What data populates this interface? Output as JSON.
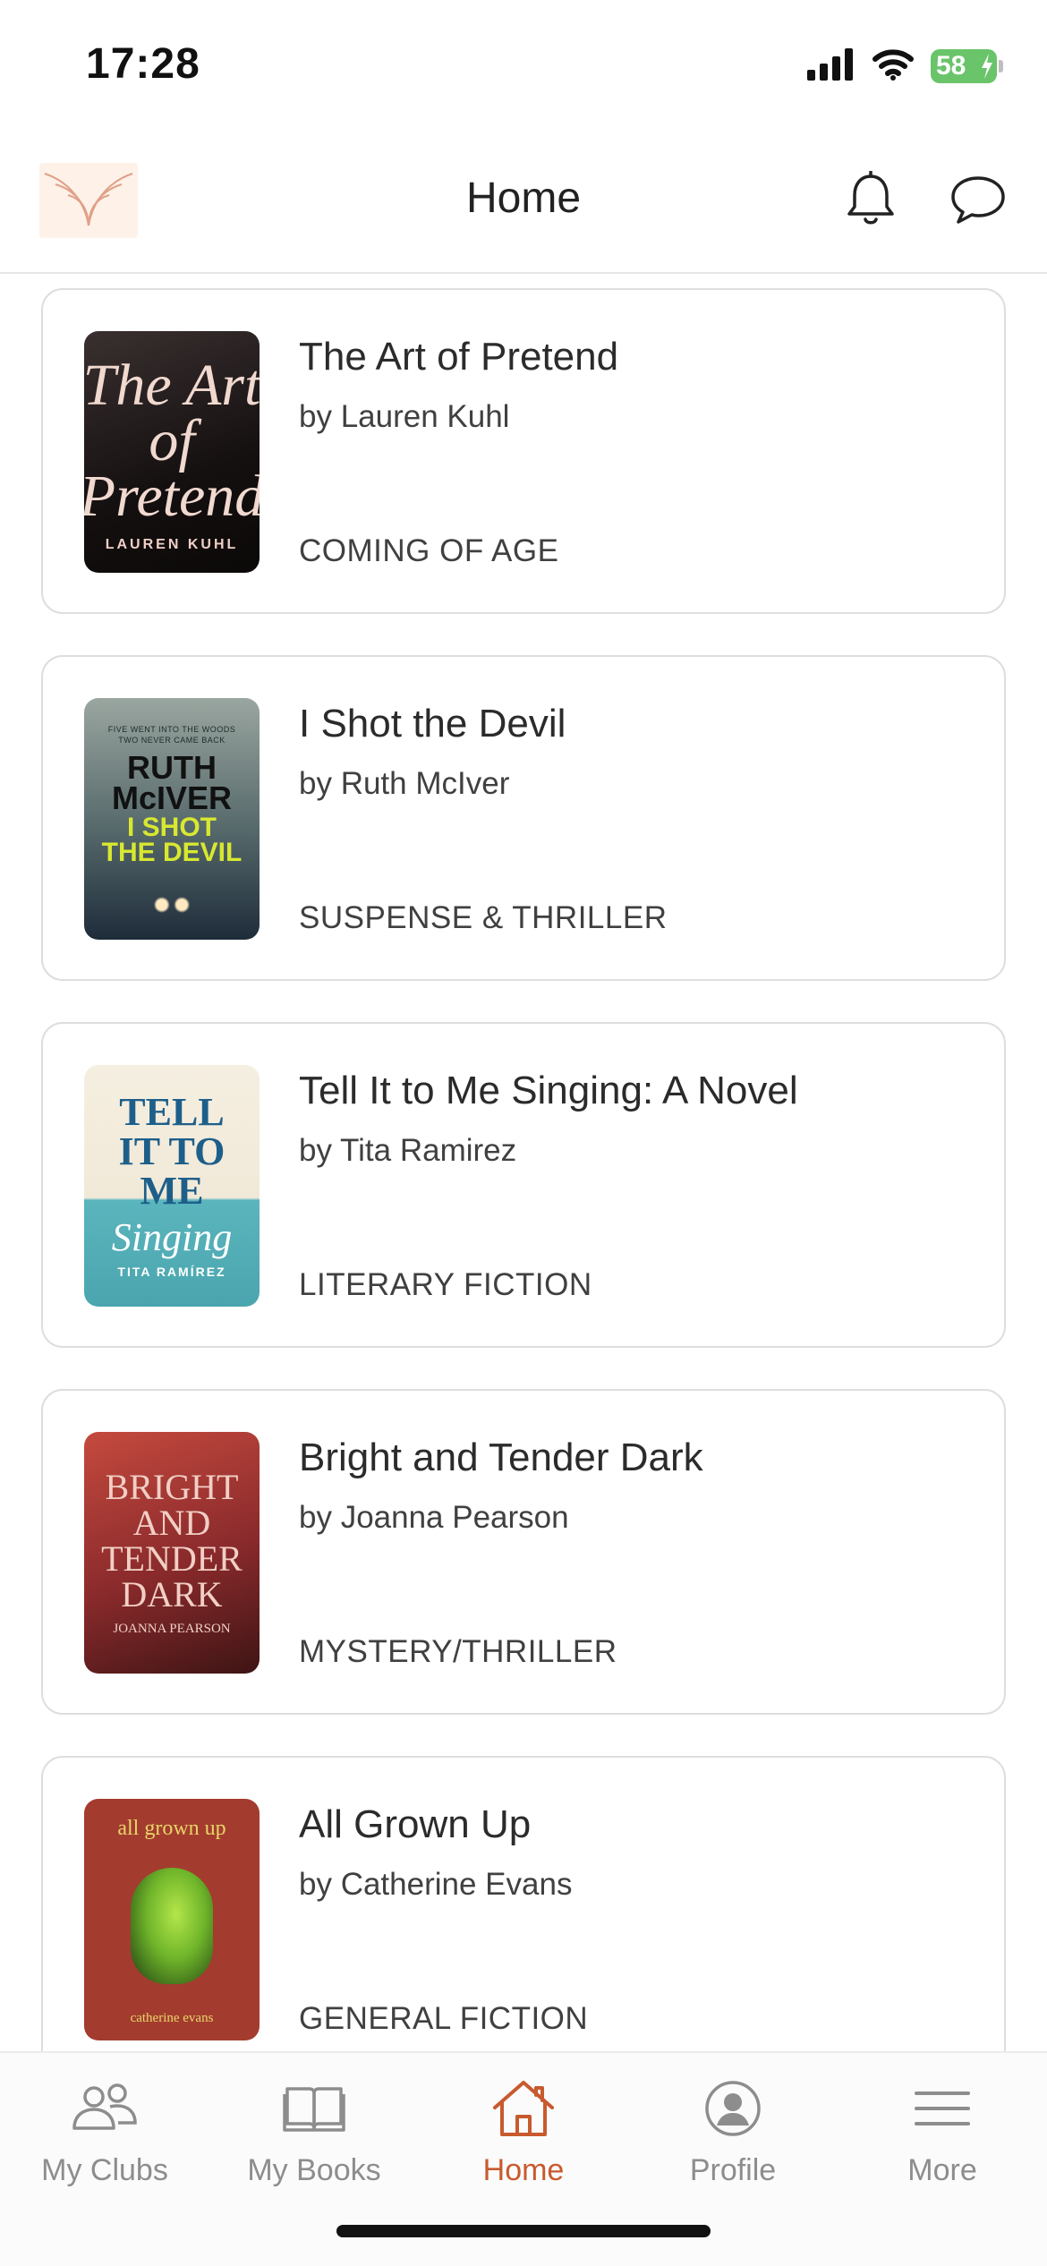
{
  "status_bar": {
    "time": "17:28",
    "battery_percent": "58",
    "icons": [
      "signal-icon",
      "wifi-icon",
      "battery-icon"
    ]
  },
  "header": {
    "title": "Home",
    "icons": [
      "app-logo",
      "bell-icon",
      "chat-bubble-icon"
    ]
  },
  "books": [
    {
      "title": "The Art of Pretend",
      "author": "by Lauren Kuhl",
      "genre": "COMING OF AGE",
      "cover": {
        "title_text": "The Art of Pretend",
        "author_text": "LAUREN KUHL"
      }
    },
    {
      "title": "I Shot the Devil",
      "author": "by Ruth McIver",
      "genre": "SUSPENSE & THRILLER",
      "cover": {
        "tagline": "FIVE WENT INTO THE WOODS TWO NEVER CAME BACK",
        "author_text": "RUTH McIVER",
        "title_text": "I SHOT THE DEVIL"
      }
    },
    {
      "title": "Tell It to Me Singing: A Novel",
      "author": "by Tita Ramirez",
      "genre": "LITERARY FICTION",
      "cover": {
        "title_text": "TELL IT TO ME",
        "title_script": "Singing",
        "author_text": "TITA RAMÍREZ"
      }
    },
    {
      "title": "Bright and Tender Dark",
      "author": "by Joanna Pearson",
      "genre": "MYSTERY/THRILLER",
      "cover": {
        "title_text": "BRIGHT AND TENDER DARK",
        "author_text": "JOANNA PEARSON"
      }
    },
    {
      "title": "All Grown Up",
      "author": "by Catherine  Evans",
      "genre": "GENERAL FICTION",
      "cover": {
        "title_text": "all grown up",
        "author_text": "catherine evans"
      }
    }
  ],
  "tab_bar": {
    "tabs": [
      {
        "label": "My Clubs",
        "icon": "people-icon",
        "active": false
      },
      {
        "label": "My Books",
        "icon": "open-book-icon",
        "active": false
      },
      {
        "label": "Home",
        "icon": "house-icon",
        "active": true
      },
      {
        "label": "Profile",
        "icon": "person-circle-icon",
        "active": false
      },
      {
        "label": "More",
        "icon": "menu-lines-icon",
        "active": false
      }
    ]
  },
  "colors": {
    "accent": "#c85a2e",
    "inactive_tab": "#8d8d8d",
    "card_border": "#dedede",
    "battery_green": "#6ac46a"
  }
}
